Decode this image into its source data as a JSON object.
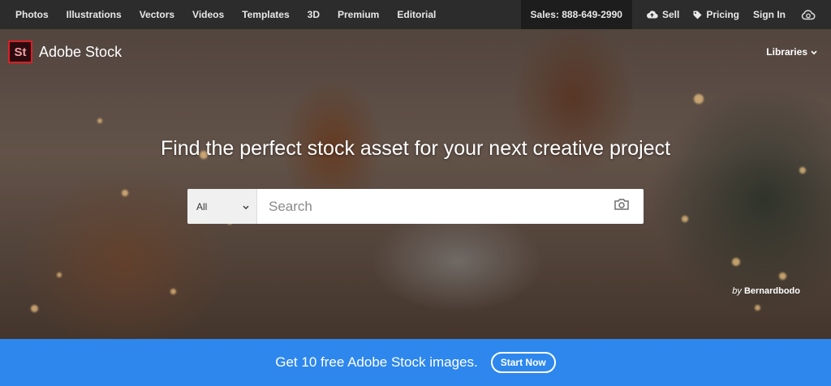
{
  "topnav": {
    "left": [
      "Photos",
      "Illustrations",
      "Vectors",
      "Videos",
      "Templates",
      "3D",
      "Premium",
      "Editorial"
    ],
    "sales": "Sales: 888-649-2990",
    "sell": "Sell",
    "pricing": "Pricing",
    "signin": "Sign In"
  },
  "brand": {
    "mark": "St",
    "name": "Adobe Stock"
  },
  "libraries": "Libraries",
  "hero": {
    "headline": "Find the perfect stock asset for your next creative project",
    "credit_prefix": "by",
    "credit_name": "Bernardbodo"
  },
  "search": {
    "scope": "All",
    "placeholder": "Search"
  },
  "promo": {
    "text": "Get 10 free Adobe Stock images.",
    "button": "Start Now"
  },
  "colors": {
    "topbar": "#2c2c2c",
    "promo": "#2d87ed",
    "brand_red": "#da1f26"
  }
}
